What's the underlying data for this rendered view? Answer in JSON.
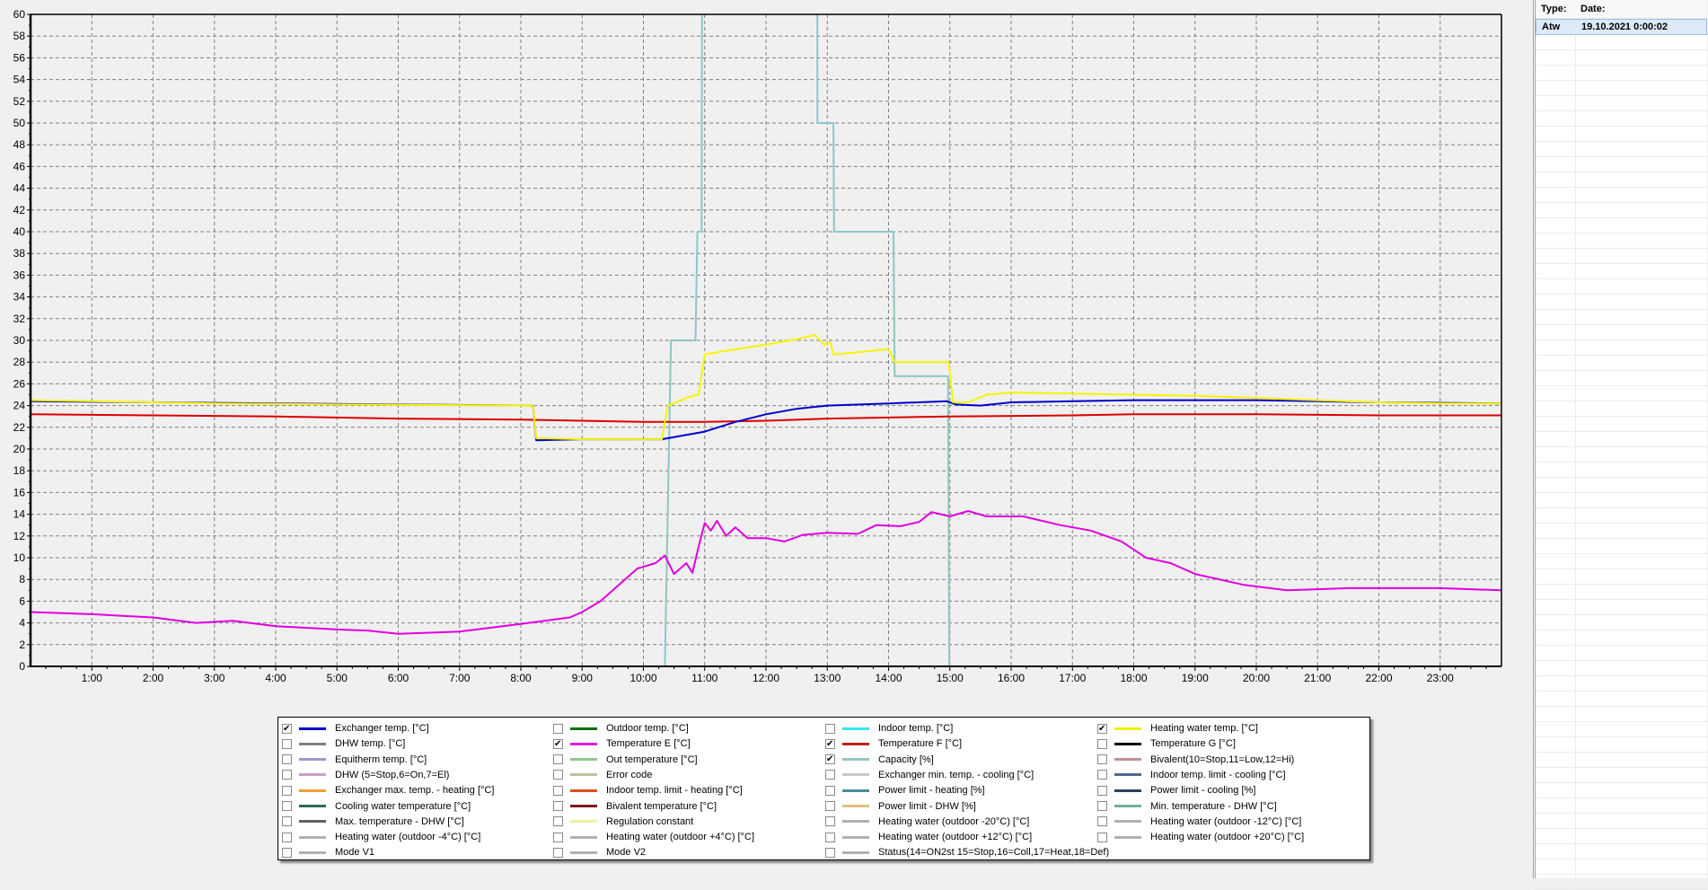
{
  "chart_data": {
    "type": "line",
    "xlabel": "",
    "ylabel": "",
    "xlim": [
      0,
      24
    ],
    "ylim": [
      0,
      60
    ],
    "y_ticks": [
      0,
      2,
      4,
      6,
      8,
      10,
      12,
      14,
      16,
      18,
      20,
      22,
      24,
      26,
      28,
      30,
      32,
      34,
      36,
      38,
      40,
      42,
      44,
      46,
      48,
      50,
      52,
      54,
      56,
      58,
      60
    ],
    "x_ticks": [
      "1:00",
      "2:00",
      "3:00",
      "4:00",
      "5:00",
      "6:00",
      "7:00",
      "8:00",
      "9:00",
      "10:00",
      "11:00",
      "12:00",
      "13:00",
      "14:00",
      "15:00",
      "16:00",
      "17:00",
      "18:00",
      "19:00",
      "20:00",
      "21:00",
      "22:00",
      "23:00"
    ],
    "grid": true,
    "legend_placement": "bottom",
    "series": [
      {
        "name": "Capacity [%]",
        "color": "#8fc6c6",
        "points": [
          [
            0,
            0
          ],
          [
            10.35,
            0
          ],
          [
            10.45,
            30
          ],
          [
            10.85,
            30
          ],
          [
            10.88,
            40
          ],
          [
            10.95,
            40
          ],
          [
            10.97,
            100
          ],
          [
            12.83,
            100
          ],
          [
            12.84,
            50
          ],
          [
            13.1,
            50
          ],
          [
            13.11,
            40
          ],
          [
            14.08,
            40
          ],
          [
            14.1,
            26.7
          ],
          [
            14.97,
            26.7
          ],
          [
            14.99,
            0
          ],
          [
            24,
            0
          ]
        ]
      },
      {
        "name": "Temperature F [°C]",
        "color": "#dd0000",
        "points": [
          [
            0,
            23.2
          ],
          [
            2,
            23.1
          ],
          [
            4,
            23.0
          ],
          [
            6,
            22.8
          ],
          [
            8,
            22.7
          ],
          [
            9,
            22.6
          ],
          [
            10,
            22.5
          ],
          [
            11,
            22.5
          ],
          [
            12,
            22.6
          ],
          [
            13,
            22.8
          ],
          [
            14,
            22.9
          ],
          [
            15,
            23.0
          ],
          [
            17,
            23.1
          ],
          [
            18,
            23.2
          ],
          [
            20,
            23.2
          ],
          [
            22,
            23.1
          ],
          [
            24,
            23.1
          ]
        ]
      },
      {
        "name": "Exchanger temp. [°C]",
        "color": "#0000cc",
        "points": [
          [
            0,
            24.4
          ],
          [
            2,
            24.3
          ],
          [
            4,
            24.2
          ],
          [
            6,
            24.1
          ],
          [
            8.2,
            24.0
          ],
          [
            8.25,
            20.8
          ],
          [
            9,
            20.9
          ],
          [
            10.3,
            20.9
          ],
          [
            10.6,
            21.2
          ],
          [
            11,
            21.6
          ],
          [
            11.5,
            22.5
          ],
          [
            12,
            23.2
          ],
          [
            12.5,
            23.7
          ],
          [
            13,
            24.0
          ],
          [
            14,
            24.2
          ],
          [
            14.95,
            24.4
          ],
          [
            15.1,
            24.1
          ],
          [
            15.5,
            24.0
          ],
          [
            16,
            24.3
          ],
          [
            17,
            24.4
          ],
          [
            18,
            24.5
          ],
          [
            20,
            24.5
          ],
          [
            21,
            24.4
          ],
          [
            22,
            24.3
          ],
          [
            24,
            24.2
          ]
        ]
      },
      {
        "name": "Heating water temp. [°C]",
        "color": "#f5f500",
        "points": [
          [
            0,
            24.5
          ],
          [
            1,
            24.4
          ],
          [
            3,
            24.2
          ],
          [
            5,
            24.1
          ],
          [
            8.2,
            24.0
          ],
          [
            8.25,
            21.0
          ],
          [
            9,
            20.9
          ],
          [
            10.3,
            20.9
          ],
          [
            10.35,
            22.5
          ],
          [
            10.4,
            24.0
          ],
          [
            10.75,
            24.8
          ],
          [
            10.9,
            25.0
          ],
          [
            11.0,
            28.7
          ],
          [
            11.3,
            29.0
          ],
          [
            12,
            29.6
          ],
          [
            12.5,
            30.1
          ],
          [
            12.8,
            30.5
          ],
          [
            12.95,
            29.6
          ],
          [
            13.05,
            29.8
          ],
          [
            13.1,
            28.7
          ],
          [
            13.5,
            28.9
          ],
          [
            14.0,
            29.2
          ],
          [
            14.1,
            28.0
          ],
          [
            14.98,
            28.0
          ],
          [
            15.05,
            24.3
          ],
          [
            15.3,
            24.3
          ],
          [
            15.6,
            25.0
          ],
          [
            16,
            25.2
          ],
          [
            17,
            25.1
          ],
          [
            18,
            25.0
          ],
          [
            19,
            24.9
          ],
          [
            20,
            24.7
          ],
          [
            21,
            24.5
          ],
          [
            22,
            24.3
          ],
          [
            23,
            24.2
          ],
          [
            24,
            24.2
          ]
        ]
      },
      {
        "name": "Temperature E [°C]",
        "color": "#e000e0",
        "points": [
          [
            0,
            5.0
          ],
          [
            1,
            4.8
          ],
          [
            2,
            4.5
          ],
          [
            2.7,
            4.0
          ],
          [
            3.3,
            4.2
          ],
          [
            4,
            3.7
          ],
          [
            5,
            3.4
          ],
          [
            5.5,
            3.3
          ],
          [
            6,
            3.0
          ],
          [
            7,
            3.2
          ],
          [
            8,
            3.9
          ],
          [
            8.8,
            4.5
          ],
          [
            9,
            5.0
          ],
          [
            9.3,
            6.0
          ],
          [
            9.6,
            7.5
          ],
          [
            9.9,
            9.0
          ],
          [
            10.2,
            9.5
          ],
          [
            10.35,
            10.2
          ],
          [
            10.5,
            8.5
          ],
          [
            10.7,
            9.5
          ],
          [
            10.8,
            8.6
          ],
          [
            10.9,
            11.0
          ],
          [
            11.0,
            13.2
          ],
          [
            11.1,
            12.5
          ],
          [
            11.2,
            13.4
          ],
          [
            11.35,
            12.0
          ],
          [
            11.5,
            12.8
          ],
          [
            11.7,
            11.8
          ],
          [
            12,
            11.8
          ],
          [
            12.3,
            11.5
          ],
          [
            12.6,
            12.1
          ],
          [
            13,
            12.3
          ],
          [
            13.5,
            12.2
          ],
          [
            13.8,
            13.0
          ],
          [
            14.2,
            12.9
          ],
          [
            14.5,
            13.3
          ],
          [
            14.7,
            14.2
          ],
          [
            15,
            13.8
          ],
          [
            15.3,
            14.3
          ],
          [
            15.6,
            13.8
          ],
          [
            16.2,
            13.8
          ],
          [
            16.8,
            13.0
          ],
          [
            17.3,
            12.5
          ],
          [
            17.8,
            11.5
          ],
          [
            18.2,
            10.0
          ],
          [
            18.6,
            9.5
          ],
          [
            19,
            8.5
          ],
          [
            19.8,
            7.5
          ],
          [
            20.5,
            7.0
          ],
          [
            21,
            7.1
          ],
          [
            21.5,
            7.2
          ],
          [
            22.5,
            7.2
          ],
          [
            23,
            7.2
          ],
          [
            24,
            7.0
          ]
        ]
      }
    ]
  },
  "legend": {
    "columns": [
      [
        {
          "label": "Exchanger temp. [°C]",
          "color": "#0000cc",
          "checked": true
        },
        {
          "label": "DHW temp. [°C]",
          "color": "#808080",
          "checked": false
        },
        {
          "label": "Equitherm temp. [°C]",
          "color": "#9a9acc",
          "checked": false
        },
        {
          "label": "DHW (5=Stop,6=On,7=El)",
          "color": "#c8a0c8",
          "checked": false
        },
        {
          "label": "Exchanger max. temp. - heating [°C]",
          "color": "#f0a030",
          "checked": false
        },
        {
          "label": "Cooling water temperature [°C]",
          "color": "#306858",
          "checked": false
        },
        {
          "label": "Max. temperature - DHW [°C]",
          "color": "#606060",
          "checked": false
        },
        {
          "label": "Heating water (outdoor -4°C) [°C]",
          "color": "#b0b0b0",
          "checked": false
        },
        {
          "label": "Mode V1",
          "color": "#b0b0b0",
          "checked": false
        }
      ],
      [
        {
          "label": "Outdoor temp. [°C]",
          "color": "#007000",
          "checked": false
        },
        {
          "label": "Temperature E [°C]",
          "color": "#e020e0",
          "checked": true
        },
        {
          "label": "Out temperature [°C]",
          "color": "#90c890",
          "checked": false
        },
        {
          "label": "Error code",
          "color": "#c0c0a0",
          "checked": false
        },
        {
          "label": "Indoor temp. limit - heating [°C]",
          "color": "#e05020",
          "checked": false
        },
        {
          "label": "Bivalent temperature [°C]",
          "color": "#801818",
          "checked": false
        },
        {
          "label": "Regulation constant",
          "color": "#f0f0a0",
          "checked": false
        },
        {
          "label": "Heating water (outdoor +4°C) [°C]",
          "color": "#b0b0b0",
          "checked": false
        },
        {
          "label": "Mode V2",
          "color": "#b0b0b0",
          "checked": false
        }
      ],
      [
        {
          "label": "Indoor temp. [°C]",
          "color": "#30e8f0",
          "checked": false
        },
        {
          "label": "Temperature F [°C]",
          "color": "#c02020",
          "checked": true
        },
        {
          "label": "Capacity [%]",
          "color": "#90c8c8",
          "checked": true
        },
        {
          "label": "Exchanger min. temp. - cooling [°C]",
          "color": "#c8c8c8",
          "checked": false
        },
        {
          "label": "Power limit - heating [%]",
          "color": "#4a8aa0",
          "checked": false
        },
        {
          "label": "Power limit - DHW [%]",
          "color": "#e0c080",
          "checked": false
        },
        {
          "label": "Heating water (outdoor -20°C) [°C]",
          "color": "#b0b0b0",
          "checked": false
        },
        {
          "label": "Heating water (outdoor +12°C) [°C]",
          "color": "#b0b0b0",
          "checked": false
        },
        {
          "label": "Status(14=ON2st 15=Stop,16=Coll,17=Heat,18=Def)",
          "color": "#b0b0b0",
          "checked": false
        }
      ],
      [
        {
          "label": "Heating water temp. [°C]",
          "color": "#f0f000",
          "checked": true
        },
        {
          "label": "Temperature G [°C]",
          "color": "#000000",
          "checked": false
        },
        {
          "label": "Bivalent(10=Stop,11=Low,12=Hi)",
          "color": "#c09090",
          "checked": false
        },
        {
          "label": "Indoor temp. limit - cooling [°C]",
          "color": "#506890",
          "checked": false
        },
        {
          "label": "Power limit - cooling [%]",
          "color": "#304060",
          "checked": false
        },
        {
          "label": "Min. temperature - DHW [°C]",
          "color": "#70b0a0",
          "checked": false
        },
        {
          "label": "Heating water (outdoor -12°C) [°C]",
          "color": "#b0b0b0",
          "checked": false
        },
        {
          "label": "Heating water (outdoor +20°C) [°C]",
          "color": "#b0b0b0",
          "checked": false
        }
      ]
    ]
  },
  "side_panel": {
    "headers": {
      "type": "Type:",
      "date": "Date:"
    },
    "rows": [
      {
        "type": "Atw",
        "date": "19.10.2021 0:00:02"
      }
    ]
  }
}
